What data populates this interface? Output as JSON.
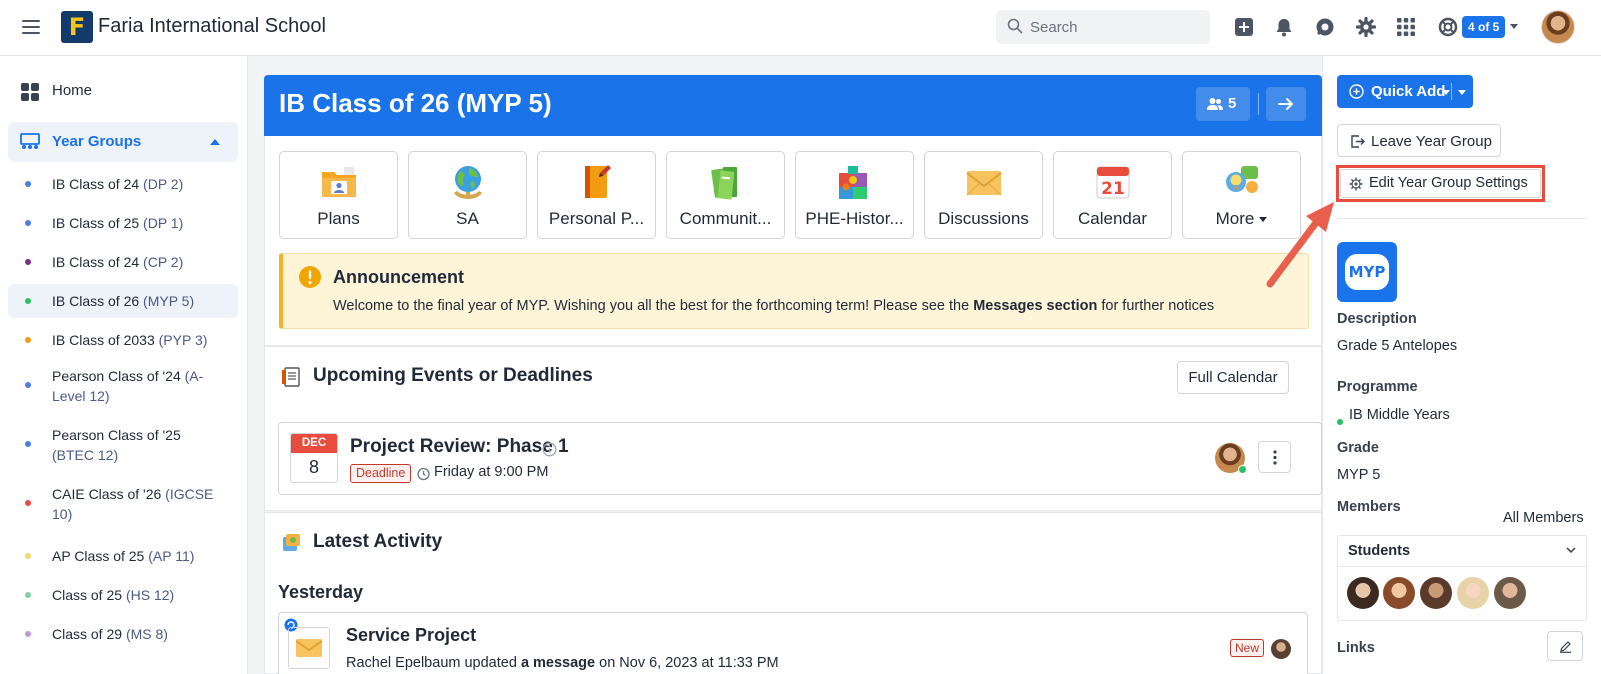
{
  "topbar": {
    "school_name": "Faria International School",
    "logo_letter": "F",
    "search_placeholder": "Search",
    "counter_badge": "4 of 5",
    "icons": [
      "menu-icon",
      "add-icon",
      "bell-icon",
      "chat-icon",
      "gear-icon",
      "apps-grid-icon",
      "help-lifebuoy-icon"
    ]
  },
  "sidebar": {
    "home_label": "Home",
    "year_groups_label": "Year Groups",
    "items": [
      {
        "name": "IB Class of 24",
        "sub": "(DP 2)",
        "color": "#4a7fe0"
      },
      {
        "name": "IB Class of 25",
        "sub": "(DP 1)",
        "color": "#4a7fe0"
      },
      {
        "name": "IB Class of 24",
        "sub": "(CP 2)",
        "color": "#7b2d8e"
      },
      {
        "name": "IB Class of 26",
        "sub": "(MYP 5)",
        "color": "#22c55e",
        "active": true
      },
      {
        "name": "IB Class of 2033",
        "sub": "(PYP 3)",
        "color": "#f39c12"
      },
      {
        "name": "Pearson Class of '24",
        "sub": "(A-Level 12)",
        "color": "#4a7fe0"
      },
      {
        "name": "Pearson Class of '25",
        "sub": "(BTEC 12)",
        "color": "#4a7fe0"
      },
      {
        "name": "CAIE Class of '26",
        "sub": "(IGCSE 10)",
        "color": "#e74c3c"
      },
      {
        "name": "AP Class of 25",
        "sub": "(AP 11)",
        "color": "#f5d76e"
      },
      {
        "name": "Class of 25",
        "sub": "(HS 12)",
        "color": "#7dd3a0"
      },
      {
        "name": "Class of 29",
        "sub": "(MS 8)",
        "color": "#c39bd3"
      }
    ]
  },
  "main": {
    "title": "IB Class of 26 (MYP 5)",
    "member_count": "5",
    "tiles": [
      {
        "label": "Plans",
        "icon": "plans-folder-icon"
      },
      {
        "label": "SA",
        "icon": "globe-icon"
      },
      {
        "label": "Personal P...",
        "icon": "notebook-icon"
      },
      {
        "label": "Communit...",
        "icon": "books-icon"
      },
      {
        "label": "PHE-Histor...",
        "icon": "puzzle-icon"
      },
      {
        "label": "Discussions",
        "icon": "envelope-icon"
      },
      {
        "label": "Calendar",
        "icon": "calendar-icon"
      },
      {
        "label": "More",
        "icon": "ideas-icon"
      }
    ],
    "calendar_tile_day": "21",
    "announcement": {
      "title": "Announcement",
      "text_before": "Welcome to the final year of MYP. Wishing you all the best for the forthcoming term! Please see the ",
      "text_bold": "Messages section",
      "text_after": " for further notices"
    },
    "upcoming": {
      "title": "Upcoming Events or Deadlines",
      "full_calendar_label": "Full Calendar",
      "event": {
        "month": "DEC",
        "day": "8",
        "title": "Project Review: Phase 1",
        "tag": "Deadline",
        "time": "Friday at 9:00 PM"
      }
    },
    "activity": {
      "title": "Latest Activity",
      "day_heading": "Yesterday",
      "item": {
        "title": "Service Project",
        "actor": "Rachel Epelbaum updated ",
        "object": "a message",
        "when": " on Nov 6, 2023 at 11:33 PM",
        "tag": "New"
      }
    }
  },
  "right_panel": {
    "quick_add_label": "Quick Add",
    "leave_label": "Leave Year Group",
    "edit_label": "Edit Year Group Settings",
    "logo_text": "MYP",
    "description_label": "Description",
    "description_value": "Grade 5 Antelopes",
    "programme_label": "Programme",
    "programme_value": "IB Middle Years",
    "grade_label": "Grade",
    "grade_value": "MYP 5",
    "members_label": "Members",
    "all_members_label": "All Members",
    "students_label": "Students",
    "links_label": "Links"
  },
  "colors": {
    "brand_blue": "#1a73e8",
    "highlight_red": "#e74c3c",
    "announcement_bg": "#fef5d9"
  }
}
